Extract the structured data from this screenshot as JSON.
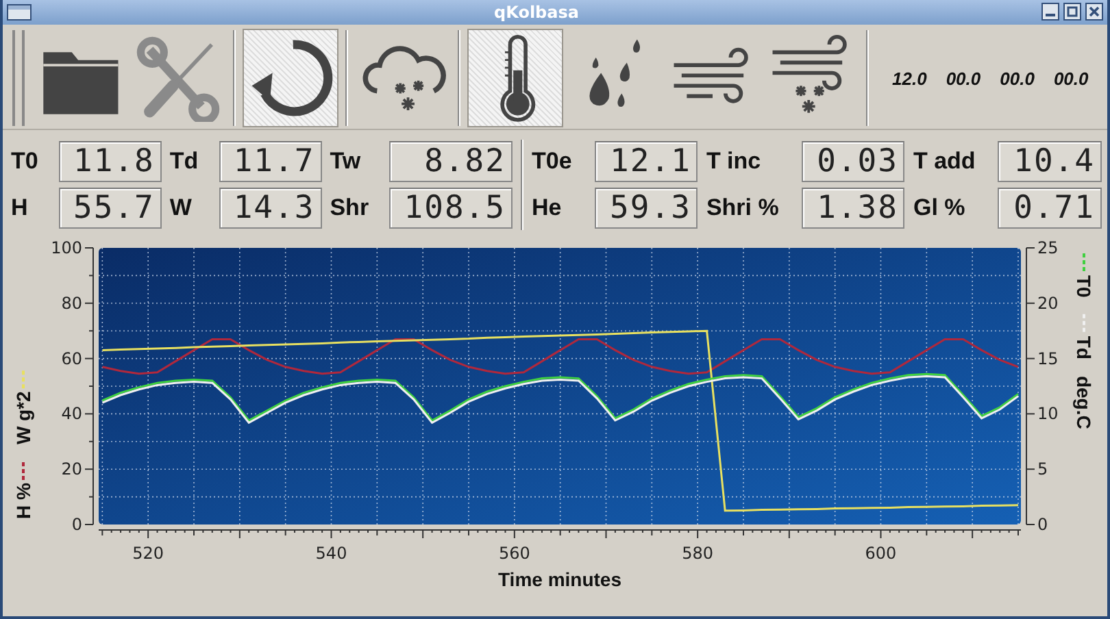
{
  "window": {
    "title": "qKolbasa"
  },
  "toolbar": {
    "buttons": [
      {
        "kind": "folder",
        "checked": false
      },
      {
        "kind": "tools",
        "checked": false
      },
      {
        "kind": "refresh",
        "checked": true
      },
      {
        "kind": "cloud-snow",
        "checked": false
      },
      {
        "kind": "thermometer",
        "checked": true
      },
      {
        "kind": "drops",
        "checked": false
      },
      {
        "kind": "wind",
        "checked": false
      },
      {
        "kind": "wind-snow",
        "checked": false
      }
    ],
    "readings": [
      "12.0",
      "00.0",
      "00.0",
      "00.0"
    ]
  },
  "readouts": [
    {
      "rows": [
        [
          {
            "label": "T0",
            "value": "11.8"
          },
          {
            "label": "Td",
            "value": "11.7"
          },
          {
            "label": "Tw",
            "value": "8.82"
          }
        ],
        [
          {
            "label": "H",
            "value": "55.7"
          },
          {
            "label": "W",
            "value": "14.3"
          },
          {
            "label": "Shr",
            "value": "108.5"
          }
        ]
      ]
    },
    {
      "rows": [
        [
          {
            "label": "T0e",
            "value": "12.1"
          },
          {
            "label": "T inc",
            "value": "0.03"
          },
          {
            "label": "T add",
            "value": "10.4"
          }
        ],
        [
          {
            "label": "He",
            "value": "59.3"
          },
          {
            "label": "Shri %",
            "value": "1.38"
          },
          {
            "label": "Gl %",
            "value": "0.71"
          }
        ]
      ]
    }
  ],
  "chart": {
    "chart_data": {
      "type": "line",
      "grid": true,
      "legend": true,
      "xlabel": "Time minutes",
      "y2label": "deg.C",
      "xlim": [
        514.6,
        615.3
      ],
      "ylim": [
        0,
        100
      ],
      "y2lim": [
        0,
        25
      ],
      "xticks": [
        520,
        540,
        560,
        580,
        600
      ],
      "yticks": [
        0,
        20,
        40,
        60,
        80,
        100
      ],
      "y2ticks": [
        0,
        5,
        10,
        15,
        20,
        25
      ],
      "x": [
        515,
        517,
        519,
        521,
        523,
        525,
        527,
        529,
        531,
        533,
        535,
        537,
        539,
        541,
        543,
        545,
        547,
        549,
        551,
        553,
        555,
        557,
        559,
        561,
        563,
        565,
        567,
        569,
        571,
        573,
        575,
        577,
        579,
        581,
        583,
        585,
        587,
        589,
        591,
        593,
        595,
        597,
        599,
        601,
        603,
        605,
        607,
        609,
        611,
        613,
        615
      ],
      "series": [
        {
          "name": "H %",
          "color": "#b0283c",
          "values": [
            57,
            55.5,
            54.5,
            55,
            59,
            63,
            67,
            67,
            63,
            59.5,
            57,
            55.5,
            54.5,
            55,
            59,
            63,
            67,
            67,
            63,
            59.5,
            57,
            55.5,
            54.5,
            55,
            59,
            63,
            67,
            67,
            63,
            59.5,
            57,
            55.5,
            54.5,
            55,
            59,
            63,
            67,
            67,
            63,
            59.5,
            57,
            55.5,
            54.5,
            55,
            59,
            63,
            67,
            67,
            63,
            59.5,
            57
          ]
        },
        {
          "name": "W g*2",
          "color": "#e8e060",
          "values": [
            63,
            63.2,
            63.4,
            63.6,
            63.8,
            64.1,
            64.3,
            64.5,
            64.7,
            64.9,
            65.1,
            65.3,
            65.5,
            65.8,
            66,
            66.2,
            66.4,
            66.6,
            66.8,
            67,
            67.2,
            67.5,
            67.7,
            67.9,
            68.1,
            68.3,
            68.5,
            68.7,
            68.9,
            69.2,
            69.4,
            69.6,
            69.8,
            70,
            5,
            5.1,
            5.3,
            5.4,
            5.5,
            5.6,
            5.8,
            5.9,
            6,
            6.1,
            6.3,
            6.4,
            6.5,
            6.6,
            6.8,
            6.9,
            7
          ]
        },
        {
          "name": "T0",
          "color": "#40d040",
          "axis": "y2",
          "values": [
            11.2,
            11.9,
            12.4,
            12.8,
            13,
            13.1,
            13,
            11.5,
            9.4,
            10.3,
            11.2,
            11.9,
            12.4,
            12.8,
            13,
            13.1,
            13,
            11.5,
            9.4,
            10.3,
            11.3,
            12,
            12.5,
            12.9,
            13.2,
            13.3,
            13.2,
            11.6,
            9.6,
            10.4,
            11.4,
            12.1,
            12.7,
            13.1,
            13.4,
            13.5,
            13.4,
            11.6,
            9.7,
            10.5,
            11.5,
            12.2,
            12.8,
            13.2,
            13.5,
            13.6,
            13.5,
            11.7,
            9.8,
            10.6,
            11.8
          ]
        },
        {
          "name": "Td",
          "color": "#f0f0f0",
          "axis": "y2",
          "values": [
            11,
            11.7,
            12.2,
            12.6,
            12.8,
            12.9,
            12.8,
            11.3,
            9.2,
            10.1,
            11,
            11.7,
            12.2,
            12.6,
            12.8,
            12.9,
            12.8,
            11.3,
            9.2,
            10.1,
            11.1,
            11.8,
            12.3,
            12.7,
            13,
            13.1,
            13,
            11.4,
            9.4,
            10.2,
            11.2,
            11.9,
            12.5,
            12.9,
            13.2,
            13.3,
            13.2,
            11.4,
            9.5,
            10.3,
            11.3,
            12,
            12.6,
            13,
            13.3,
            13.4,
            13.3,
            11.5,
            9.6,
            10.4,
            11.6
          ]
        }
      ]
    }
  }
}
